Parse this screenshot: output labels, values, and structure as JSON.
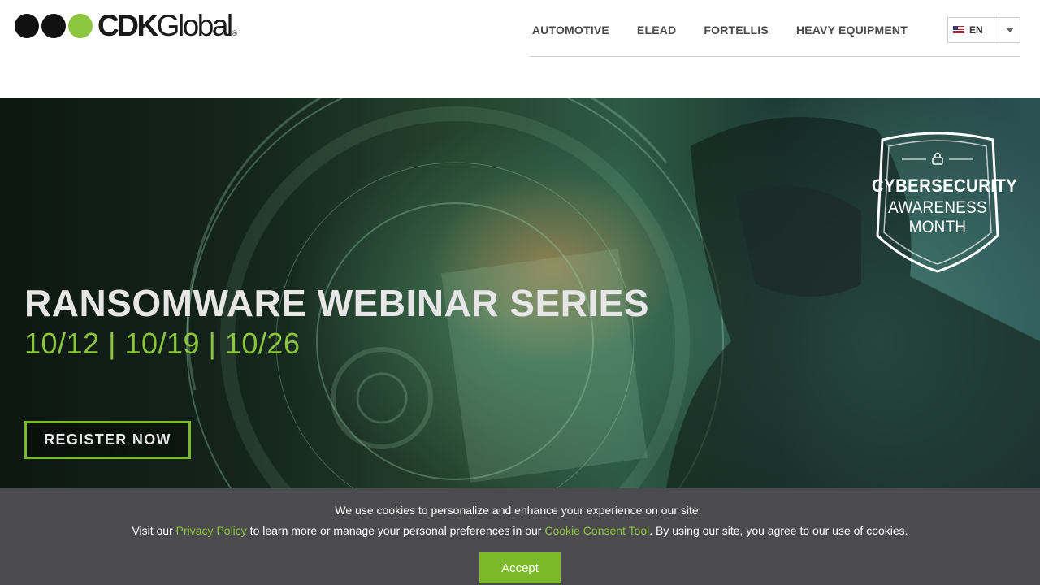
{
  "header": {
    "logo": {
      "text_bold": "CDK",
      "text_light": "Global",
      "reg_mark": "®",
      "dot_colors": [
        "#111111",
        "#111111",
        "#8cc63f"
      ]
    },
    "nav": [
      {
        "label": "AUTOMOTIVE"
      },
      {
        "label": "ELEAD"
      },
      {
        "label": "FORTELLIS"
      },
      {
        "label": "HEAVY EQUIPMENT"
      }
    ],
    "language": {
      "code": "EN",
      "flag": "us-flag-icon"
    }
  },
  "hero": {
    "title": "RANSOMWARE WEBINAR SERIES",
    "dates": "10/12 | 10/19 | 10/26",
    "cta_label": "REGISTER NOW",
    "badge": {
      "line1": "CYBERSECURITY",
      "line2": "AWARENESS",
      "line3": "MONTH",
      "icon": "lock-icon"
    }
  },
  "cookie_banner": {
    "line1": "We use cookies to personalize and enhance your experience on our site.",
    "line2_prefix": "Visit our ",
    "privacy_link": "Privacy Policy",
    "line2_middle": " to learn more or manage your personal preferences in our ",
    "consent_link": "Cookie Consent Tool",
    "line2_suffix": ". By using our site, you agree to our use of cookies.",
    "accept_label": "Accept"
  },
  "colors": {
    "brand_green": "#7ab929",
    "link_green": "#8cc63f",
    "banner_bg": "#4b4b4d",
    "nav_text": "#4a4a4a"
  }
}
